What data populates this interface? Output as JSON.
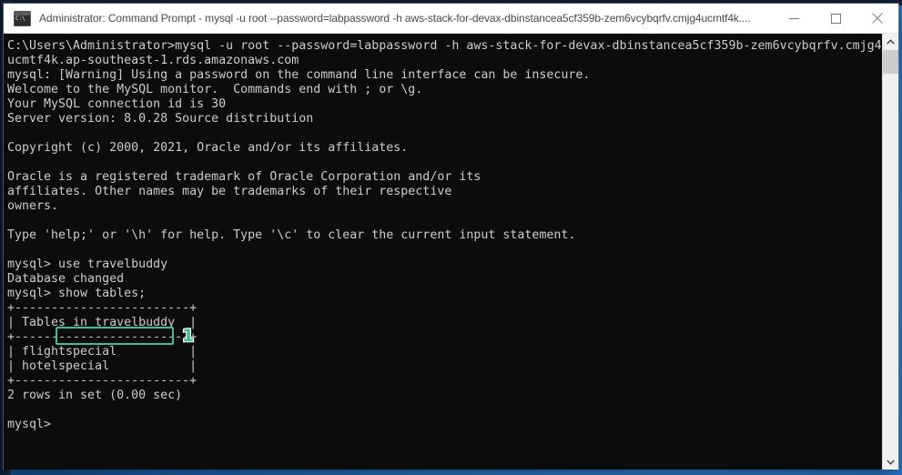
{
  "window": {
    "title": "Administrator: Command Prompt - mysql  -u root --password=labpassword -h aws-stack-for-devax-dbinstancea5cf359b-zem6vcybqrfv.cmjg4ucmtf4k....",
    "icon_name": "command-prompt-icon",
    "icon_prompt_text": "C:\\",
    "controls": {
      "minimize_label": "Minimize",
      "maximize_label": "Maximize",
      "close_label": "Close"
    }
  },
  "console": {
    "background_color": "#0c0c0c",
    "text_color": "#cccccc",
    "content": "C:\\Users\\Administrator>mysql -u root --password=labpassword -h aws-stack-for-devax-dbinstancea5cf359b-zem6vcybqrfv.cmjg4\nucmtf4k.ap-southeast-1.rds.amazonaws.com\nmysql: [Warning] Using a password on the command line interface can be insecure.\nWelcome to the MySQL monitor.  Commands end with ; or \\g.\nYour MySQL connection id is 30\nServer version: 8.0.28 Source distribution\n\nCopyright (c) 2000, 2021, Oracle and/or its affiliates.\n\nOracle is a registered trademark of Oracle Corporation and/or its\naffiliates. Other names may be trademarks of their respective\nowners.\n\nType 'help;' or '\\h' for help. Type '\\c' to clear the current input statement.\n\nmysql> use travelbuddy\nDatabase changed\nmysql> show tables;\n+------------------------+\n| Tables_in_travelbuddy  |\n+------------------------+\n| flightspecial          |\n| hotelspecial           |\n+------------------------+\n2 rows in set (0.00 sec)\n\nmysql>"
  },
  "annotation": {
    "highlight_target": "show tables;",
    "badge_number": "1",
    "accent_color": "#3fbd9b"
  },
  "scrollbar": {
    "up_arrow_label": "Scroll up",
    "down_arrow_label": "Scroll down",
    "thumb_label": "Scroll thumb"
  }
}
